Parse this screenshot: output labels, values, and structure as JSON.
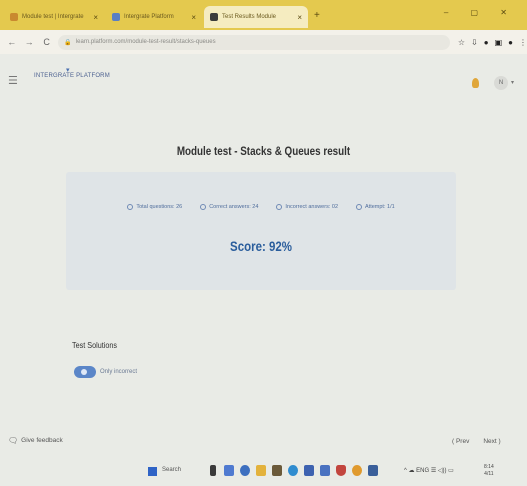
{
  "browser": {
    "tabs": [
      {
        "label": "Module test | Intergrate",
        "close": "×",
        "icon_color": "#c9892f"
      },
      {
        "label": "Intergrate Platform",
        "close": "×",
        "icon_color": "#5a7fc4"
      },
      {
        "label": "Test Results Module",
        "close": "×",
        "icon_color": "#3c3c3c"
      }
    ],
    "new_tab": "+",
    "window_controls": "– ▢ ✕",
    "nav_back": "←",
    "nav_forward": "→",
    "reload": "C",
    "url": "learn.platform.com/module-test-result/stacks-queues",
    "toolbar_icons": [
      "☆",
      "⇩",
      "●",
      "▣",
      "●",
      "⋮"
    ]
  },
  "app": {
    "menu_icon": "☰",
    "brand": "INTERGRATE PLATFORM",
    "brand_mark": "▾",
    "avatar_text": "N",
    "avatar_caret": "▾"
  },
  "result": {
    "title": "Module test - Stacks & Queues result",
    "stats": [
      {
        "label": "Total questions: 26"
      },
      {
        "label": "Correct answers: 24"
      },
      {
        "label": "Incorrect answers: 02"
      },
      {
        "label": "Attempt: 1/1"
      }
    ],
    "score": "Score: 92%"
  },
  "solutions": {
    "title": "Test Solutions",
    "toggle_label": "Only incorrect",
    "toggle_on": true
  },
  "footer": {
    "feedback_icon": "🗨",
    "feedback_label": "Give feedback",
    "prev": "( Prev",
    "next": "Next )"
  },
  "taskbar": {
    "search_label": "Search",
    "tray_text": "^ ☁ ENG ☰ ◁)) ▭",
    "clock_time": "8:14",
    "clock_date": "4/11"
  }
}
